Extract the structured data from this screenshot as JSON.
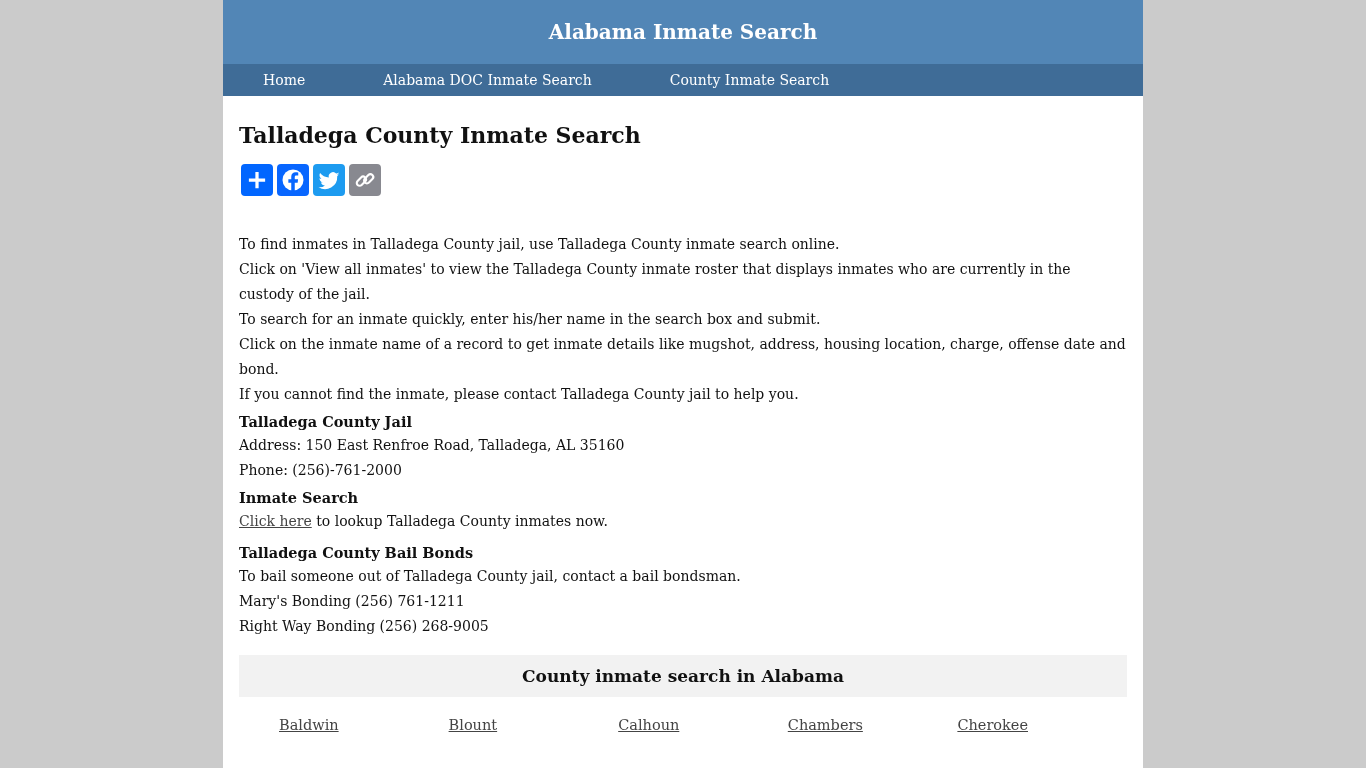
{
  "site_title": "Alabama Inmate Search",
  "nav": [
    {
      "label": "Home"
    },
    {
      "label": "Alabama DOC Inmate Search"
    },
    {
      "label": "County Inmate Search"
    }
  ],
  "page_title": "Talladega County Inmate Search",
  "share_buttons": [
    {
      "kind": "add"
    },
    {
      "kind": "facebook"
    },
    {
      "kind": "twitter"
    },
    {
      "kind": "copy"
    }
  ],
  "intro": [
    "To find inmates in Talladega County jail, use Talladega County inmate search online.",
    "Click on 'View all inmates' to view the Talladega County inmate roster that displays inmates who are currently in the custody of the jail.",
    "To search for an inmate quickly, enter his/her name in the search box and submit.",
    "Click on the inmate name of a record to get inmate details like mugshot, address, housing location, charge, offense date and bond.",
    "If you cannot find the inmate, please contact Talladega County jail to help you."
  ],
  "jail": {
    "heading": "Talladega County Jail",
    "lines": [
      "Address: 150 East Renfroe Road, Talladega, AL 35160",
      "Phone: (256)-761-2000"
    ]
  },
  "inmate_search": {
    "heading": "Inmate Search",
    "link": "Click here",
    "text": " to lookup Talladega County inmates now."
  },
  "bail": {
    "heading": "Talladega County Bail Bonds",
    "lines": [
      "To bail someone out of Talladega County jail, contact a bail bondsman.",
      "Mary's Bonding (256) 761-1211",
      "Right Way Bonding (256) 268-9005"
    ]
  },
  "county_section": {
    "heading": "County inmate search in Alabama",
    "counties": [
      "Baldwin",
      "Blount",
      "Calhoun",
      "Chambers",
      "Cherokee"
    ]
  }
}
